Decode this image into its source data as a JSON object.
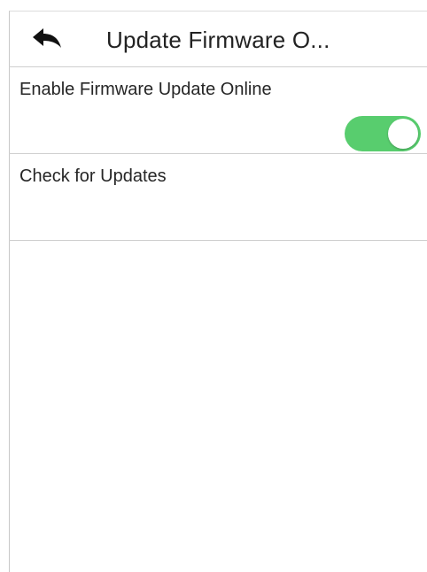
{
  "header": {
    "title": "Update Firmware O..."
  },
  "settings": {
    "firmware_online": {
      "label": "Enable Firmware Update Online",
      "enabled": true
    },
    "check_updates": {
      "label": "Check for Updates"
    }
  },
  "icons": {
    "back": "back-arrow-icon"
  },
  "colors": {
    "toggle_on": "#58cd6e",
    "divider": "#cfcfcf",
    "background": "#ffffff"
  }
}
